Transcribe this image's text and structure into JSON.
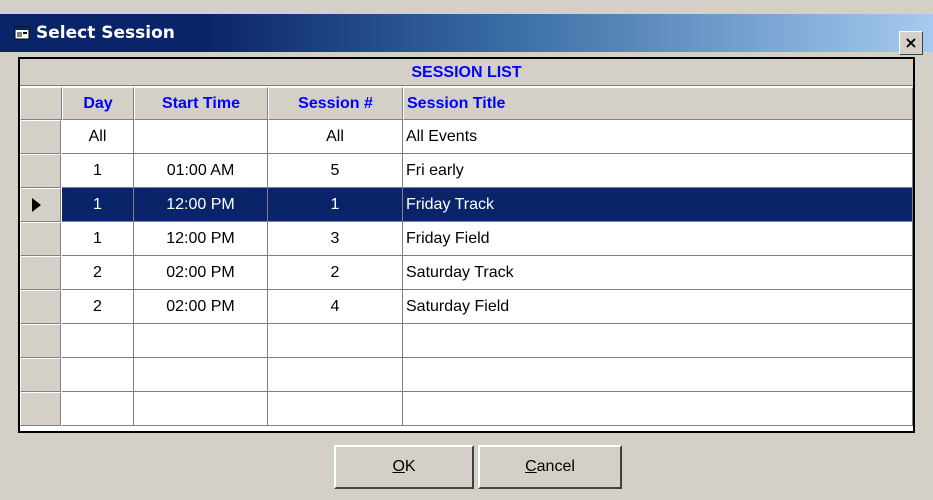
{
  "window": {
    "title": "Select Session",
    "close_glyph": "×",
    "icon": "window-app-icon"
  },
  "grid": {
    "caption": "SESSION LIST",
    "columns": [
      "Day",
      "Start Time",
      "Session #",
      "Session Title"
    ],
    "rows": [
      {
        "day": "All",
        "start": "",
        "session": "All",
        "title": "All Events",
        "selected": false
      },
      {
        "day": "1",
        "start": "01:00 AM",
        "session": "5",
        "title": "Fri early",
        "selected": false
      },
      {
        "day": "1",
        "start": "12:00 PM",
        "session": "1",
        "title": "Friday Track",
        "selected": true
      },
      {
        "day": "1",
        "start": "12:00 PM",
        "session": "3",
        "title": "Friday Field",
        "selected": false
      },
      {
        "day": "2",
        "start": "02:00 PM",
        "session": "2",
        "title": "Saturday Track",
        "selected": false
      },
      {
        "day": "2",
        "start": "02:00 PM",
        "session": "4",
        "title": "Saturday Field",
        "selected": false
      },
      {
        "day": "",
        "start": "",
        "session": "",
        "title": "",
        "selected": false
      },
      {
        "day": "",
        "start": "",
        "session": "",
        "title": "",
        "selected": false
      },
      {
        "day": "",
        "start": "",
        "session": "",
        "title": "",
        "selected": false
      }
    ],
    "selected_color": "#0a246a",
    "header_text_color": "#0000ff"
  },
  "buttons": {
    "ok_mnemonic": "O",
    "ok_rest": "K",
    "cancel_mnemonic": "C",
    "cancel_rest": "ancel"
  }
}
